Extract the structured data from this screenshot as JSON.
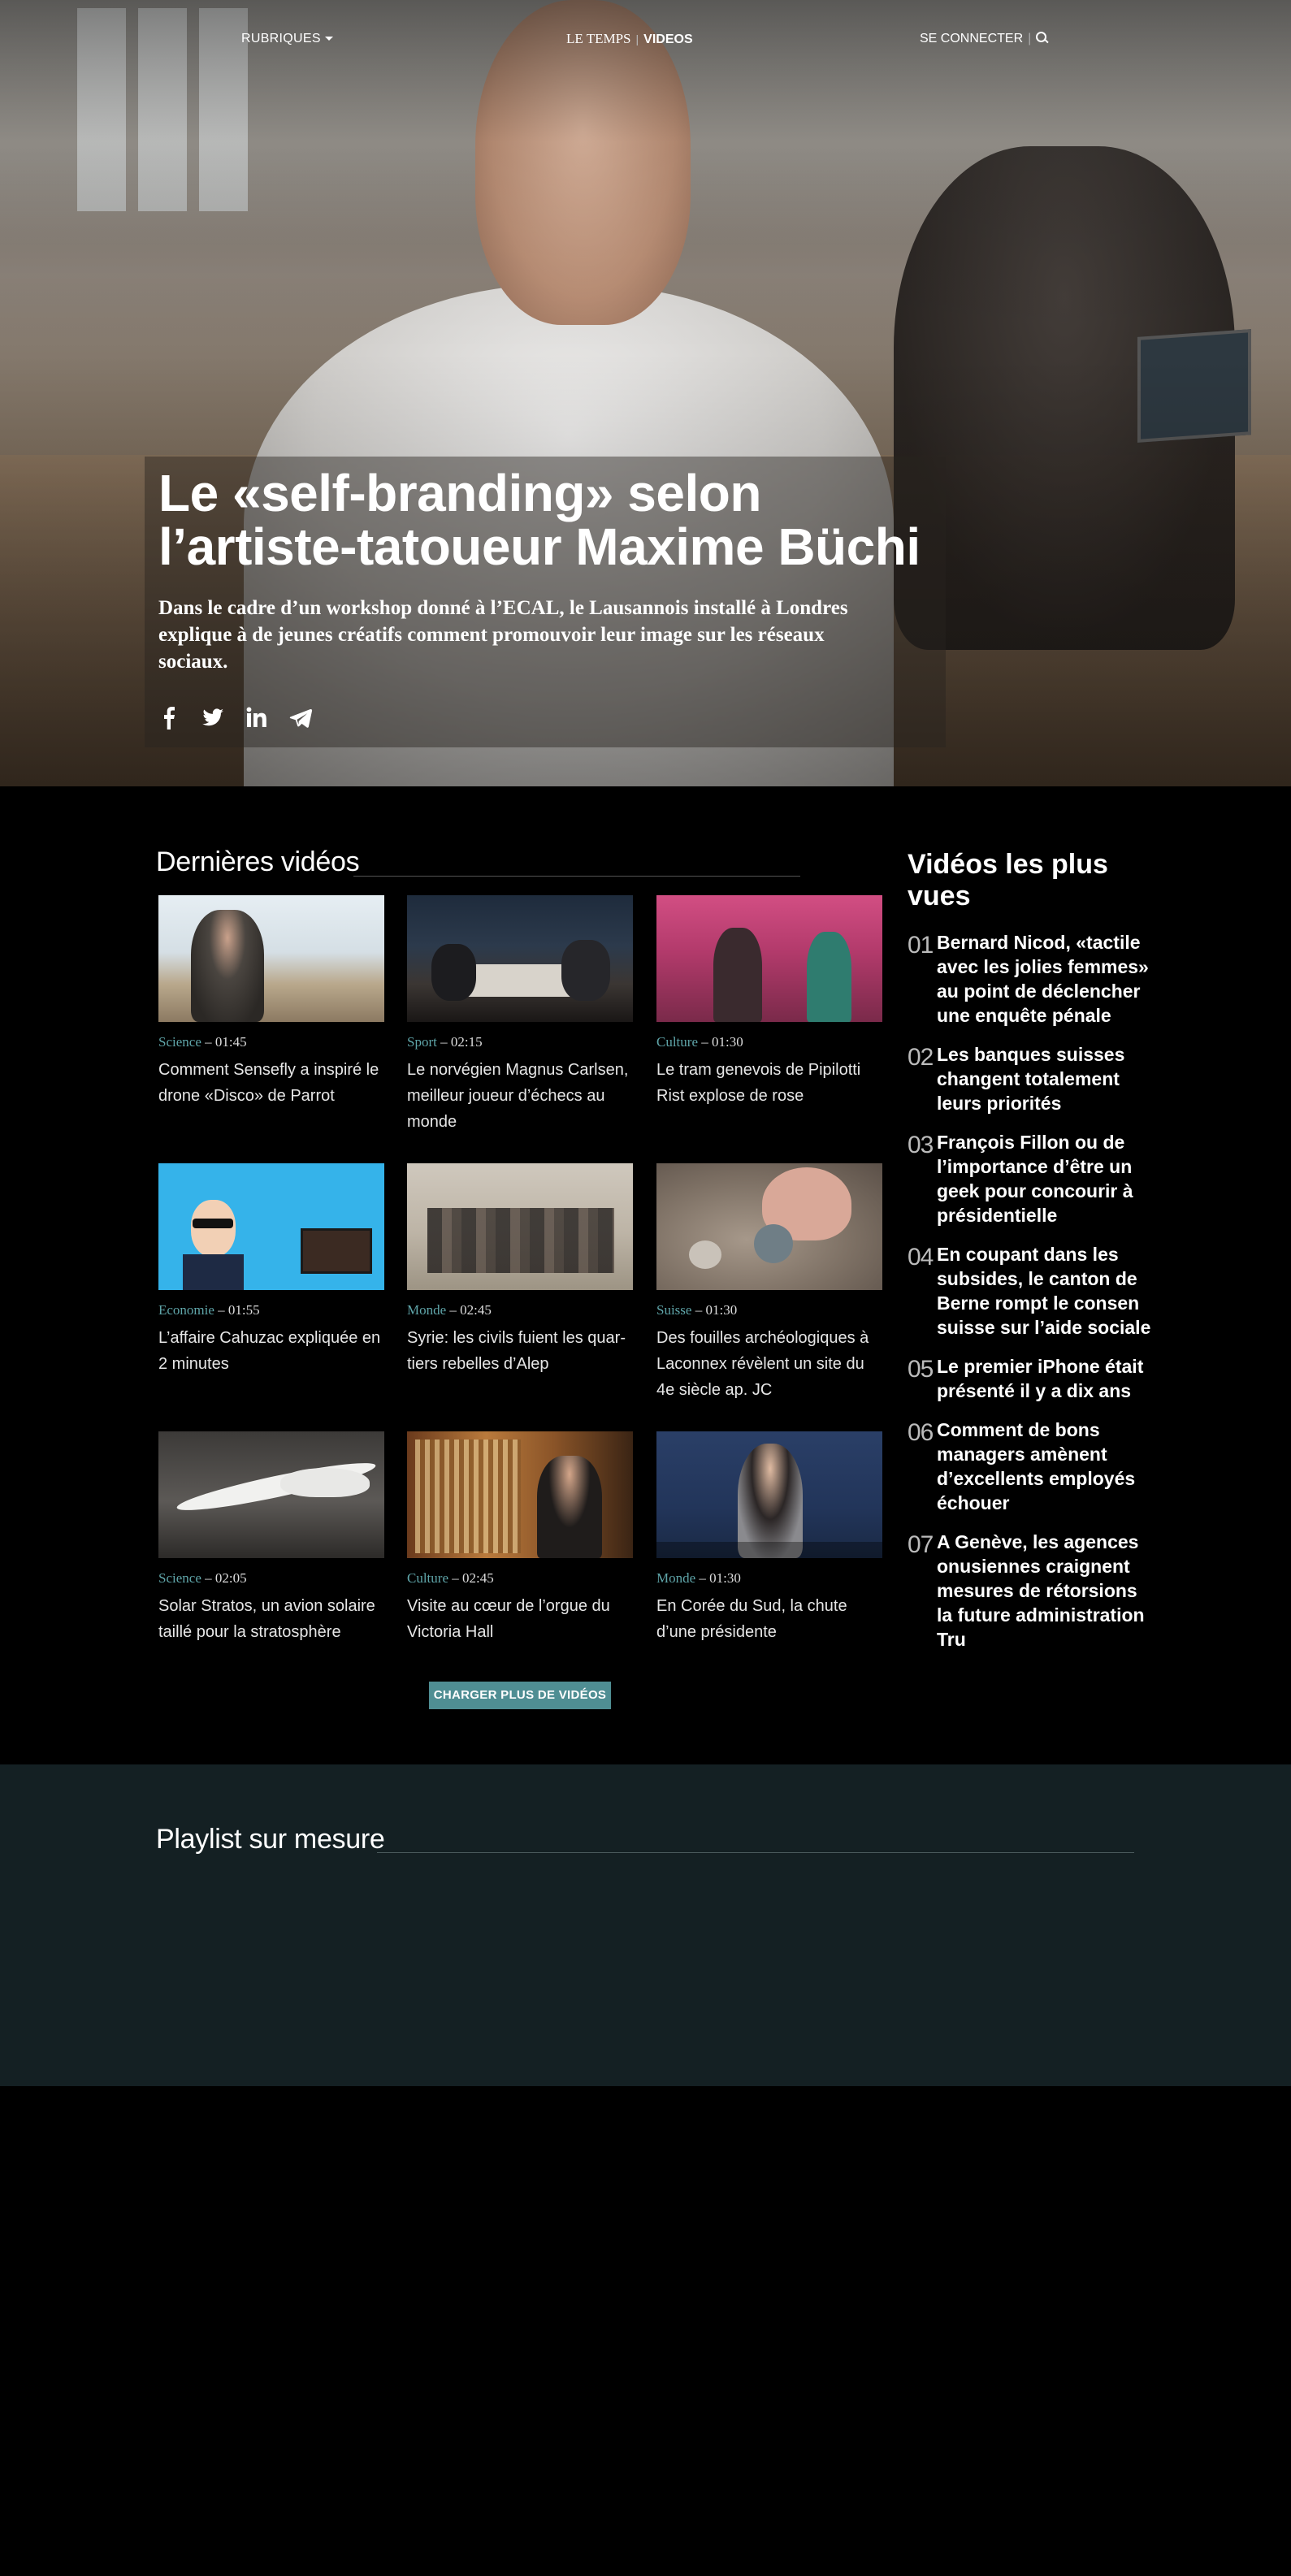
{
  "nav": {
    "rubriques": "RUBRIQUES",
    "brand": "LE TEMPS",
    "brand_section": "VIDEOS",
    "login": "SE CONNECTER"
  },
  "hero": {
    "title": "Le «self-branding» selon l’artiste-tatoueur Maxime Büchi",
    "lead": "Dans le cadre d’un workshop donné à l’ECAL, le Lausannois installé à Londres explique à de jeunes créatifs comment promouvoir leur image sur les réseaux sociaux.",
    "share_icons": [
      "facebook-icon",
      "twitter-icon",
      "linkedin-icon",
      "telegram-icon"
    ]
  },
  "latest": {
    "title": "Dernières vidéos",
    "items": [
      {
        "category": "Science",
        "duration": "01:45",
        "title": "Comment Sensefly a inspiré le drone «Disco» de Parrot"
      },
      {
        "category": "Sport",
        "duration": "02:15",
        "title": "Le norvégien Magnus Carlsen, meilleur joueur d’échecs au monde"
      },
      {
        "category": "Culture",
        "duration": "01:30",
        "title": "Le tram genevois de Pipilotti Rist explose de rose"
      },
      {
        "category": "Economie",
        "duration": "01:55",
        "title": "L’affaire Cahuzac expliquée en 2 minutes"
      },
      {
        "category": "Monde",
        "duration": "02:45",
        "title": "Syrie: les civils fuient les quar-tiers rebelles d’Alep"
      },
      {
        "category": "Suisse",
        "duration": "01:30",
        "title": "Des fouilles archéologiques à Laconnex révèlent un site du 4e siècle ap. JC"
      },
      {
        "category": "Science",
        "duration": "02:05",
        "title": "Solar Stratos, un avion solaire taillé pour la stratosphère"
      },
      {
        "category": "Culture",
        "duration": "02:45",
        "title": "Visite au cœur de l’orgue du Victoria Hall"
      },
      {
        "category": "Monde",
        "duration": "01:30",
        "title": "En Corée du Sud, la chute d’une présidente"
      }
    ],
    "more_button": "CHARGER PLUS DE VIDÉOS"
  },
  "most_viewed": {
    "title": "Vidéos les plus vues",
    "items": [
      {
        "num": "01",
        "title": "Bernard Nicod, «tactile avec les jolies femmes» au point de déclencher une enquête pénale"
      },
      {
        "num": "02",
        "title": "Les banques suisses changent totalement leurs priorités"
      },
      {
        "num": "03",
        "title": "François Fillon ou de l’importance d’être un geek pour concourir à présidentielle"
      },
      {
        "num": "04",
        "title": "En coupant dans les subsides, le canton de Berne rompt le consen suisse sur l’aide sociale"
      },
      {
        "num": "05",
        "title": "Le premier iPhone était présenté il y a dix ans"
      },
      {
        "num": "06",
        "title": "Comment de bons managers amènent d’excellents employés échouer"
      },
      {
        "num": "07",
        "title": "A Genève, les agences onusiennes craignent mesures de rétorsions la future administration Tru"
      }
    ]
  },
  "playlist": {
    "title": "Playlist sur mesure"
  },
  "colors": {
    "accent": "#4f8e93",
    "category": "#5fa5a9",
    "playlist_bg": "#142023"
  }
}
